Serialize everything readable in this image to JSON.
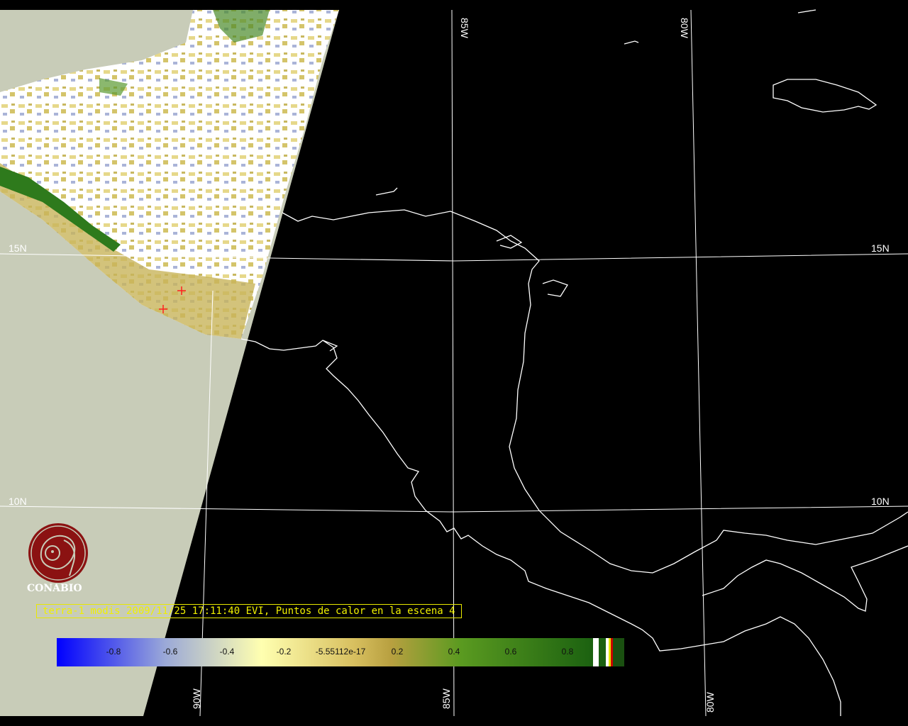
{
  "map": {
    "latitude_labels": {
      "lat_15": "15N",
      "lat_10": "10N"
    },
    "longitude_labels": {
      "lon_90": "90W",
      "lon_85": "85W",
      "lon_80": "80W"
    }
  },
  "caption": "terra-1 modis 2009/11/25 17:11:40 EVI, Puntos de calor en la escena 4",
  "logo": {
    "text": "CONABIO"
  },
  "legend": {
    "ticks": [
      "-0.8",
      "-0.6",
      "-0.4",
      "-0.2",
      "-5.55112e-17",
      "0.2",
      "0.4",
      "0.6",
      "0.8"
    ]
  },
  "colors": {
    "land_outline": "#ffffff",
    "nodata": "#c8ccb8",
    "caption": "#f0f000",
    "logo": "#8b1212"
  }
}
